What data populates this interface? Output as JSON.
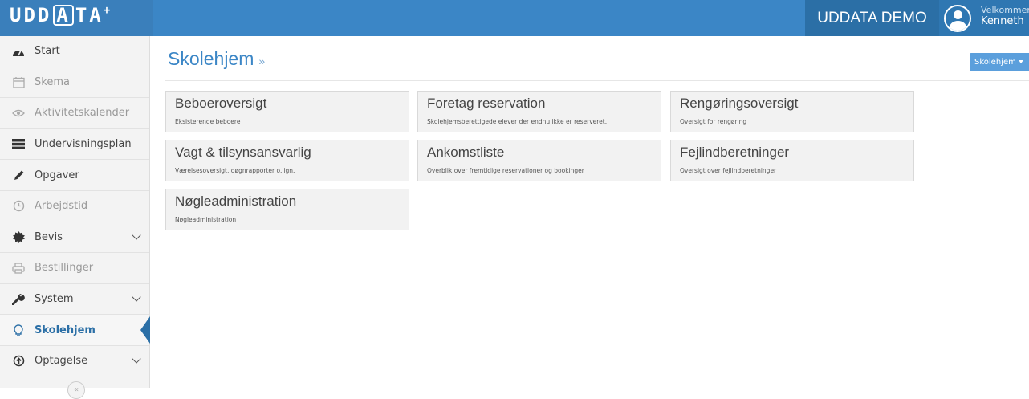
{
  "header": {
    "logo_main": "UDD",
    "logo_boxed": "A",
    "logo_tail": "TA",
    "logo_plus": "+",
    "demo_label": "UDDATA DEMO",
    "welcome_line1": "Velkommen",
    "welcome_line2": "Kenneth"
  },
  "sidebar": {
    "items": [
      {
        "label": "Start",
        "icon": "dashboard-icon"
      },
      {
        "label": "Skema",
        "icon": "calendar-icon"
      },
      {
        "label": "Aktivitetskalender",
        "icon": "eye-icon"
      },
      {
        "label": "Undervisningsplan",
        "icon": "list-icon"
      },
      {
        "label": "Opgaver",
        "icon": "pencil-icon"
      },
      {
        "label": "Arbejdstid",
        "icon": "clock-icon"
      },
      {
        "label": "Bevis",
        "icon": "certificate-icon"
      },
      {
        "label": "Bestillinger",
        "icon": "printer-icon"
      },
      {
        "label": "System",
        "icon": "wrench-icon"
      },
      {
        "label": "Skolehjem",
        "icon": "lightbulb-icon"
      },
      {
        "label": "Optagelse",
        "icon": "arrow-up-circle-icon"
      }
    ],
    "collapse_glyph": "«"
  },
  "main": {
    "title": "Skolehjem",
    "title_suffix": "»",
    "dropdown_label": "Skolehjem",
    "tiles": [
      {
        "title": "Beboeroversigt",
        "subtitle": "Eksisterende beboere"
      },
      {
        "title": "Foretag reservation",
        "subtitle": "Skolehjemsberettigede elever der endnu ikke er reserveret."
      },
      {
        "title": "Rengøringsoversigt",
        "subtitle": "Oversigt for rengøring"
      },
      {
        "title": "Vagt & tilsynsansvarlig",
        "subtitle": "Værelsesoversigt, døgnrapporter o.lign."
      },
      {
        "title": "Ankomstliste",
        "subtitle": "Overblik over fremtidige reservationer og bookinger"
      },
      {
        "title": "Fejlindberetninger",
        "subtitle": "Oversigt over fejlindberetninger"
      },
      {
        "title": "Nøgleadministration",
        "subtitle": "Nøgleadministration"
      }
    ]
  },
  "colors": {
    "brand_blue": "#3b86c6",
    "header_dark": "#2b6fa6",
    "accent_button": "#5b9fdc"
  }
}
